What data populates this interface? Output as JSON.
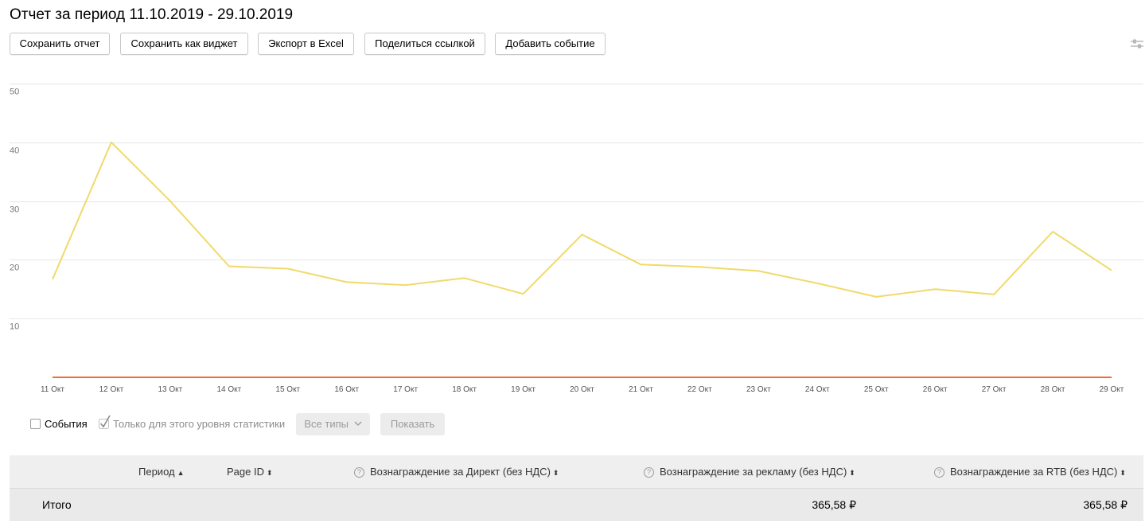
{
  "page_title": "Отчет за период 11.10.2019 - 29.10.2019",
  "toolbar": {
    "save_report": "Сохранить отчет",
    "save_widget": "Сохранить как виджет",
    "export_excel": "Экспорт в Excel",
    "share_link": "Поделиться ссылкой",
    "add_event": "Добавить событие"
  },
  "settings_icon": "sliders-icon",
  "chart_data": {
    "type": "line",
    "x": [
      "11 Окт",
      "12 Окт",
      "13 Окт",
      "14 Окт",
      "15 Окт",
      "16 Окт",
      "17 Окт",
      "18 Окт",
      "19 Окт",
      "20 Окт",
      "21 Окт",
      "22 Окт",
      "23 Окт",
      "24 Окт",
      "25 Окт",
      "26 Окт",
      "27 Окт",
      "28 Окт",
      "29 Окт"
    ],
    "series": [
      {
        "color": "#f0da6a",
        "values": [
          16.7,
          40,
          30,
          18.9,
          18.5,
          16.2,
          15.7,
          16.9,
          14.2,
          24.3,
          19.2,
          18.8,
          18.1,
          16,
          13.7,
          15,
          14.1,
          24.8,
          18.2
        ]
      },
      {
        "color": "#f46a3a",
        "values": [
          0,
          0,
          0,
          0,
          0,
          0,
          0,
          0,
          0,
          0,
          0,
          0,
          0,
          0,
          0,
          0,
          0,
          0,
          0
        ]
      }
    ],
    "yticks": [
      "50",
      "40",
      "30",
      "20",
      "10"
    ],
    "ylim": [
      0,
      50
    ],
    "grid": true
  },
  "controls": {
    "events_label": "События",
    "events_checked": false,
    "only_level_label": "Только для этого уровня статистики",
    "only_level_checked": true,
    "all_types": "Все типы",
    "show": "Показать"
  },
  "table": {
    "columns": [
      {
        "label": "Период",
        "sort": "▲"
      },
      {
        "label": "Page ID",
        "sort": "⬍"
      },
      {
        "label": "Вознаграждение за Директ (без НДС)",
        "sort": "⬍",
        "help": true
      },
      {
        "label": "Вознаграждение за рекламу (без НДС)",
        "sort": "⬍",
        "help": true
      },
      {
        "label": "Вознаграждение за RTB (без НДС)",
        "sort": "⬍",
        "help": true
      }
    ],
    "total_row": {
      "label": "Итого",
      "ad_reward": "365,58 ₽",
      "rtb_reward": "365,58 ₽"
    }
  }
}
